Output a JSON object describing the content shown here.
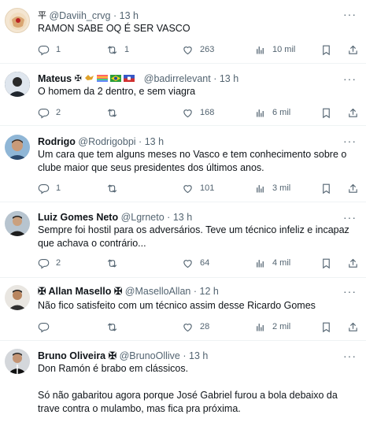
{
  "tweets": [
    {
      "name": "",
      "name_badges": "平",
      "handle": "@Daviih_crvg",
      "dot": "·",
      "time": "13 h",
      "more": "···",
      "text": [
        "RAMON SABE OQ É SER VASCO"
      ],
      "replies": "1",
      "retweets": "1",
      "likes": "263",
      "views": "10 mil"
    },
    {
      "name": "Mateus",
      "name_badges": "✠",
      "handle": "@badirrelevant",
      "dot": "·",
      "time": "13 h",
      "more": "···",
      "text": [
        "O homem da 2 dentro, e sem viagra"
      ],
      "replies": "2",
      "retweets": "",
      "likes": "168",
      "views": "6 mil"
    },
    {
      "name": "Rodrigo",
      "name_badges": "",
      "handle": "@Rodrigobpi",
      "dot": "·",
      "time": "13 h",
      "more": "···",
      "text": [
        "Um cara que tem alguns meses no Vasco e tem conhecimento sobre o clube maior que seus presidentes dos últimos anos."
      ],
      "replies": "1",
      "retweets": "",
      "likes": "101",
      "views": "3 mil"
    },
    {
      "name": "Luiz Gomes Neto",
      "name_badges": "",
      "handle": "@Lgrneto",
      "dot": "·",
      "time": "13 h",
      "more": "···",
      "text": [
        "Sempre foi hostil para os adversários. Teve um técnico infeliz e incapaz que achava o contrário..."
      ],
      "replies": "2",
      "retweets": "",
      "likes": "64",
      "views": "4 mil"
    },
    {
      "name": "✠ Allan Masello ✠",
      "name_badges": "",
      "handle": "@MaselloAllan",
      "dot": "·",
      "time": "12 h",
      "more": "···",
      "text": [
        "Não fico satisfeito com um técnico assim desse Ricardo Gomes"
      ],
      "replies": "",
      "retweets": "",
      "likes": "28",
      "views": "2 mil"
    },
    {
      "name": "Bruno Oliveira ✠",
      "name_badges": "",
      "handle": "@BrunoOllive",
      "dot": "·",
      "time": "13 h",
      "more": "···",
      "text": [
        "Don Ramón é brabo em clássicos.",
        "Só não gabaritou agora porque José Gabriel furou a bola debaixo da trave contra o mulambo, mas fica pra próxima."
      ],
      "replies": "",
      "retweets": "",
      "likes": "",
      "views": ""
    }
  ],
  "icons": {
    "reply": "reply-icon",
    "retweet": "retweet-icon",
    "like": "like-icon",
    "views": "views-icon",
    "bookmark": "bookmark-icon",
    "share": "share-icon"
  },
  "colors": {
    "text": "#0f1419",
    "secondary": "#536471",
    "divider": "#eff3f4"
  }
}
